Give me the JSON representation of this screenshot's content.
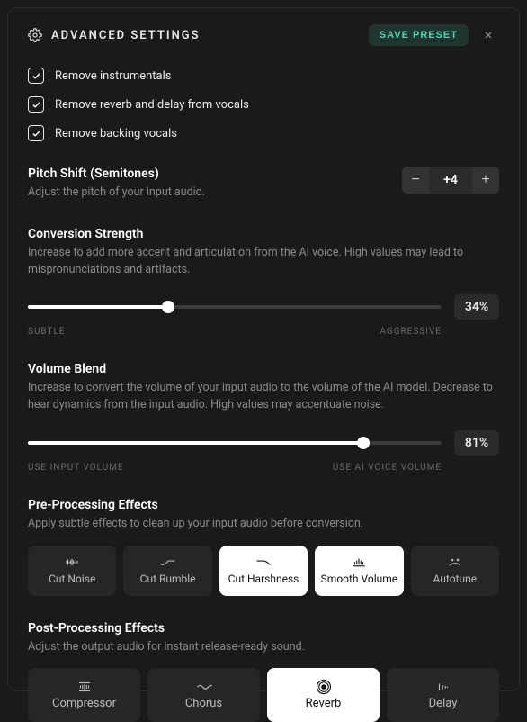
{
  "header": {
    "title": "ADVANCED SETTINGS",
    "save_label": "SAVE PRESET"
  },
  "checkboxes": [
    {
      "label": "Remove instrumentals",
      "checked": true
    },
    {
      "label": "Remove reverb and delay from vocals",
      "checked": true
    },
    {
      "label": "Remove backing vocals",
      "checked": true
    }
  ],
  "pitch": {
    "title": "Pitch Shift (Semitones)",
    "desc": "Adjust the pitch of your input audio.",
    "value": "+4"
  },
  "strength": {
    "title": "Conversion Strength",
    "desc": "Increase to add more accent and articulation from the AI voice. High values may lead to mispronunciations and artifacts.",
    "value": "34%",
    "percent": 34,
    "left_label": "SUBTLE",
    "right_label": "AGGRESSIVE"
  },
  "volume": {
    "title": "Volume Blend",
    "desc": "Increase to convert the volume of your input audio to the volume of the AI model. Decrease to hear dynamics from the input audio. High values may accentuate noise.",
    "value": "81%",
    "percent": 81,
    "left_label": "USE INPUT VOLUME",
    "right_label": "USE AI VOICE VOLUME"
  },
  "pre": {
    "title": "Pre-Processing Effects",
    "desc": "Apply subtle effects to clean up your input audio before conversion.",
    "items": [
      {
        "label": "Cut Noise",
        "active": false
      },
      {
        "label": "Cut Rumble",
        "active": false
      },
      {
        "label": "Cut Harshness",
        "active": true
      },
      {
        "label": "Smooth Volume",
        "active": true
      },
      {
        "label": "Autotune",
        "active": false
      }
    ]
  },
  "post": {
    "title": "Post-Processing Effects",
    "desc": "Adjust the output audio for instant release-ready sound.",
    "items": [
      {
        "label": "Compressor",
        "active": false
      },
      {
        "label": "Chorus",
        "active": false
      },
      {
        "label": "Reverb",
        "active": true
      },
      {
        "label": "Delay",
        "active": false
      }
    ]
  }
}
